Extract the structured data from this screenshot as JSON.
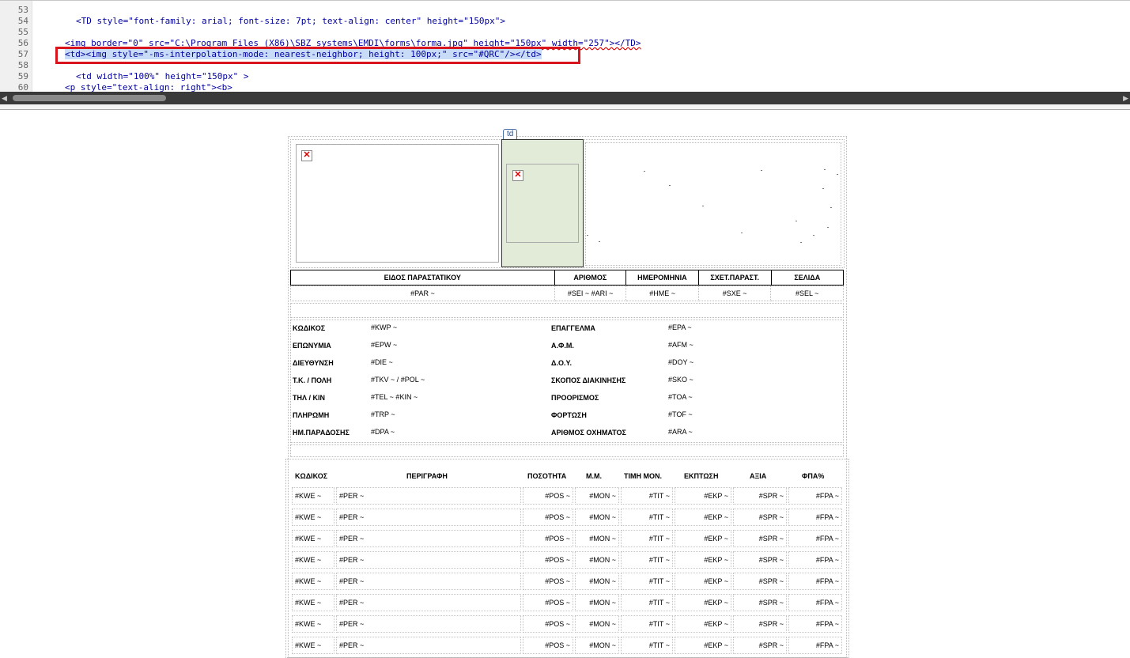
{
  "editor": {
    "lines": [
      {
        "num": "53",
        "text": ""
      },
      {
        "num": "54",
        "text": "<TD style=\"font-family: arial; font-size: 7pt; text-align: center\" height=\"150px\">"
      },
      {
        "num": "55",
        "text": ""
      },
      {
        "num": "56",
        "text": "<img border=\"0\" src=\"C:\\Program Files (X86)\\SBZ systems\\EMDI\\forms\\forma.jpg\" height=\"150px\" width=\"257\"></TD>"
      },
      {
        "num": "57",
        "text": "<td><img style=\"-ms-interpolation-mode: nearest-neighbor; height: 100px;\" src=\"#QRC\"/></td>"
      },
      {
        "num": "58",
        "text": ""
      },
      {
        "num": "59",
        "text": "<td width=\"100%\" height=\"150px\" >"
      },
      {
        "num": "60",
        "text": "<p style=\"text-align: right\"><b>"
      }
    ],
    "highlight_color": "#d8151c"
  },
  "design": {
    "td_tag_label": "td",
    "broken_image_glyph": "✕",
    "doc_header": {
      "columns": [
        "ΕΙΔΟΣ ΠΑΡΑΣΤΑΤΙΚΟΥ",
        "ΑΡΙΘΜΟΣ",
        "ΗΜΕΡΟΜΗΝΙΑ",
        "ΣΧΕΤ.ΠΑΡΑΣΤ.",
        "ΣΕΛΙΔΑ"
      ],
      "values": [
        "#PAR ~",
        "#SEI ~ #ARI ~",
        "#HME ~",
        "#SXE ~",
        "#SEL ~"
      ]
    },
    "customer": {
      "left": [
        {
          "label": "ΚΩΔΙΚΟΣ",
          "value": "#KWP ~"
        },
        {
          "label": "ΕΠΩΝΥΜΙΑ",
          "value": "#EPW ~"
        },
        {
          "label": "ΔΙΕΥΘΥΝΣΗ",
          "value": "#DIE ~"
        },
        {
          "label": "Τ.Κ. / ΠΟΛΗ",
          "value": "#TKV ~ / #POL ~"
        },
        {
          "label": "ΤΗΛ / ΚΙΝ",
          "value": "#TEL ~ #KIN ~"
        },
        {
          "label": "ΠΛΗΡΩΜΗ",
          "value": "#TRP ~"
        },
        {
          "label": "ΗΜ.ΠΑΡΑΔΟΣΗΣ",
          "value": "#DPA ~"
        }
      ],
      "right": [
        {
          "label": "ΕΠΑΓΓΕΛΜΑ",
          "value": "#EPA ~"
        },
        {
          "label": "Α.Φ.Μ.",
          "value": "#AFM ~"
        },
        {
          "label": "Δ.Ο.Υ.",
          "value": "#DOY ~"
        },
        {
          "label": "ΣΚΟΠΟΣ ΔΙΑΚΙΝΗΣΗΣ",
          "value": "#SKO ~"
        },
        {
          "label": "ΠΡΟΟΡΙΣΜΟΣ",
          "value": "#TOA ~"
        },
        {
          "label": "ΦΟΡΤΩΣΗ",
          "value": "#TOF ~"
        },
        {
          "label": "ΑΡΙΘΜΟΣ ΟΧΗΜΑΤΟΣ",
          "value": "#ARA ~"
        }
      ]
    },
    "items": {
      "headers": [
        "ΚΩΔΙΚΟΣ",
        "ΠΕΡΙΓΡΑΦΗ",
        "ΠΟΣΟΤΗΤΑ",
        "Μ.Μ.",
        "ΤΙΜΗ ΜΟΝ.",
        "ΕΚΠΤΩΣΗ",
        "ΑΞΙΑ",
        "ΦΠΑ%"
      ],
      "row": [
        "#KWE ~",
        "#PER ~",
        "#POS ~",
        "#MON ~",
        "#TIT ~",
        "#EKP ~",
        "#SPR ~",
        "#FPA ~"
      ],
      "row_count": 8
    }
  }
}
